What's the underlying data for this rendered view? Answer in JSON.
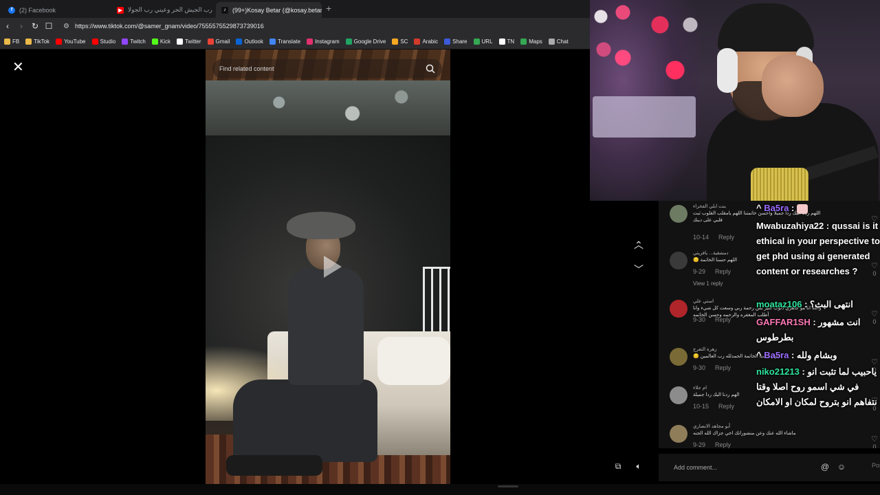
{
  "browser": {
    "tabs": [
      {
        "label": "(2) Facebook",
        "favicon": "facebook-icon",
        "color": "#1877f2"
      },
      {
        "label": "عيني رب الجيش الحر وعيني رب الجولا...",
        "favicon": "youtube-icon",
        "color": "#ff0000"
      },
      {
        "label": "(99+)Kosay Betar (@kosay.betar...",
        "favicon": "tiktok-icon",
        "color": "#000000"
      }
    ],
    "new_tab": "+",
    "url": "https://www.tiktok.com/@samer_gnam/video/7555575529873739016",
    "bookmarks": [
      {
        "label": "FB",
        "icon": "folder-icon",
        "color": "#e9b949"
      },
      {
        "label": "TikTok",
        "icon": "folder-icon",
        "color": "#e9b949"
      },
      {
        "label": "YouTube",
        "icon": "youtube-icon",
        "color": "#ff0000"
      },
      {
        "label": "Studio",
        "icon": "youtube-studio-icon",
        "color": "#ff0000"
      },
      {
        "label": "Twitch",
        "icon": "twitch-icon",
        "color": "#9146ff"
      },
      {
        "label": "Kick",
        "icon": "kick-icon",
        "color": "#53fc18"
      },
      {
        "label": "Twitter",
        "icon": "x-icon",
        "color": "#ffffff"
      },
      {
        "label": "Gmail",
        "icon": "gmail-icon",
        "color": "#ea4335"
      },
      {
        "label": "Outlook",
        "icon": "outlook-icon",
        "color": "#0a64d6"
      },
      {
        "label": "Translate",
        "icon": "translate-icon",
        "color": "#4285f4"
      },
      {
        "label": "Instagram",
        "icon": "instagram-icon",
        "color": "#e1306c"
      },
      {
        "label": "Google Drive",
        "icon": "drive-icon",
        "color": "#1fa463"
      },
      {
        "label": "SC",
        "icon": "sc-icon",
        "color": "#f7a823"
      },
      {
        "label": "Arabic",
        "icon": "arabic-icon",
        "color": "#d23a2a"
      },
      {
        "label": "Share",
        "icon": "share-icon",
        "color": "#3b5bdb"
      },
      {
        "label": "URL",
        "icon": "url-icon",
        "color": "#34a853"
      },
      {
        "label": "TN",
        "icon": "tn-icon",
        "color": "#ffffff"
      },
      {
        "label": "Maps",
        "icon": "maps-icon",
        "color": "#34a853"
      },
      {
        "label": "Chat",
        "icon": "chat-icon",
        "color": "#aaaaaa"
      }
    ]
  },
  "tiktok": {
    "search_placeholder": "Find related content",
    "comments": [
      {
        "name": "بنت ابلي الفخراء",
        "text": "اللهم ردنا اليك ردا جميلا واحسن خاتمتنا اللهم يامقلب القلوب ثبت قلبي على دينك",
        "date": "10-14",
        "reply": "Reply",
        "likes": "0"
      },
      {
        "name": "دمشقية... يافريتي",
        "text": "اللهم حسنا الخاتمة 😔",
        "date": "9-29",
        "reply": "Reply",
        "likes": "0",
        "view_replies": "View 1 reply"
      },
      {
        "name": "استي علي",
        "text": "والله انا مو جاهزي ذنوب كثير بس رحمة ربي وسعت كل شيء وانا أطلب المغفره والرحمه وحسن الخاتمه",
        "date": "9-30",
        "reply": "Reply",
        "likes": "0"
      },
      {
        "name": "زهرة التفرج",
        "text": "اللهم حسنا الخاتمة الحمدلله رب العالمين 😔",
        "date": "9-30",
        "reply": "Reply",
        "likes": "0"
      },
      {
        "name": "ام جلاء",
        "text": "الهم ردنا اليك ردا جميلة",
        "date": "10-15",
        "reply": "Reply",
        "likes": "0"
      },
      {
        "name": "أبو مجاهد الانصاري",
        "text": "ماشاء الله عنك وعن منشوراتك اخي جزاك الله الجنه",
        "date": "9-29",
        "reply": "Reply",
        "likes": "0"
      }
    ],
    "add_comment_placeholder": "Add comment...",
    "post_label": "Post"
  },
  "chat": [
    {
      "user": "Ba5ra",
      "user_color": "#9b6bff",
      "message": ""
    },
    {
      "user": "Mwabuzahiya22",
      "user_color": "#ffffff",
      "message": "qussai is it ethical in your perspective to get phd using ai generated content or researches ?"
    },
    {
      "user": "moataz106",
      "user_color": "#2ee59d",
      "message": "انتهى البث؟"
    },
    {
      "user": "GAFFAR1SH",
      "user_color": "#ff7ab8",
      "message": "انت مشهور بطرطوس"
    },
    {
      "user": "Ba5ra",
      "user_color": "#9b6bff",
      "message": "وبشام ولله"
    },
    {
      "user": "niko21213",
      "user_color": "#2ee59d",
      "message": "ياحبيب لما تثبت انو في شي اسمو روح اصلا وقتا نتفاهم انو بتروح لمكان او الامكان"
    }
  ]
}
